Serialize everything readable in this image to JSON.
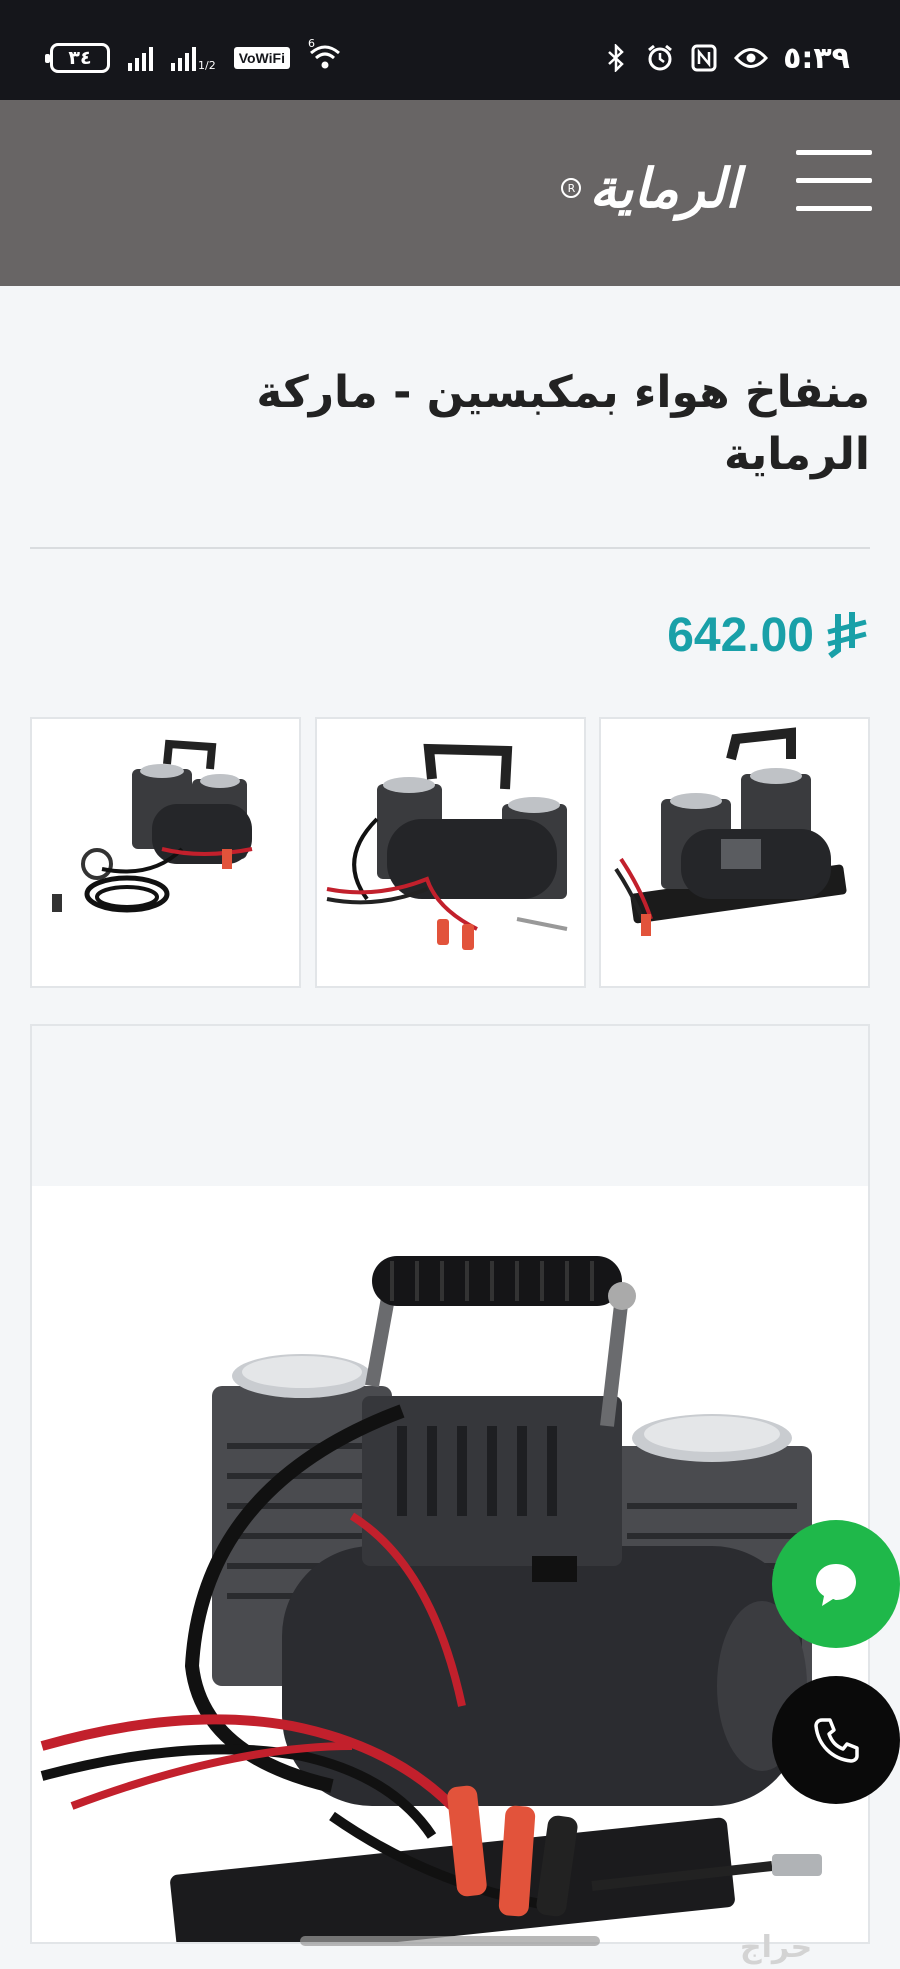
{
  "status_bar": {
    "battery": "٣٤",
    "sim2_label": "1/2",
    "vowifi": "VoWiFi",
    "wifi_badge": "6",
    "time": "٥:٣٩",
    "icons": [
      "signal-icon",
      "wifi-icon",
      "bluetooth-icon",
      "alarm-icon",
      "nfc-icon",
      "eye-icon"
    ]
  },
  "header": {
    "logo_text": "الرماية",
    "logo_mark": "R",
    "menu_icon": "hamburger-menu-icon",
    "bg_color": "#686565"
  },
  "product": {
    "title": "منفاخ هواء بمكبسين - ماركة الرماية",
    "price": "642.00",
    "currency_icon": "riyal-symbol-icon",
    "price_color": "#19a0a8"
  },
  "gallery": {
    "thumbnails": [
      "compressor-with-gauge-hose",
      "compressor-side-view",
      "compressor-front-view"
    ],
    "main_image": "compressor-main-photo"
  },
  "floating_actions": {
    "chat_icon": "chat-bubble-icon",
    "chat_color": "#1fb84a",
    "call_icon": "phone-icon",
    "call_color": "#0a0a0a"
  },
  "watermark": "حراج"
}
